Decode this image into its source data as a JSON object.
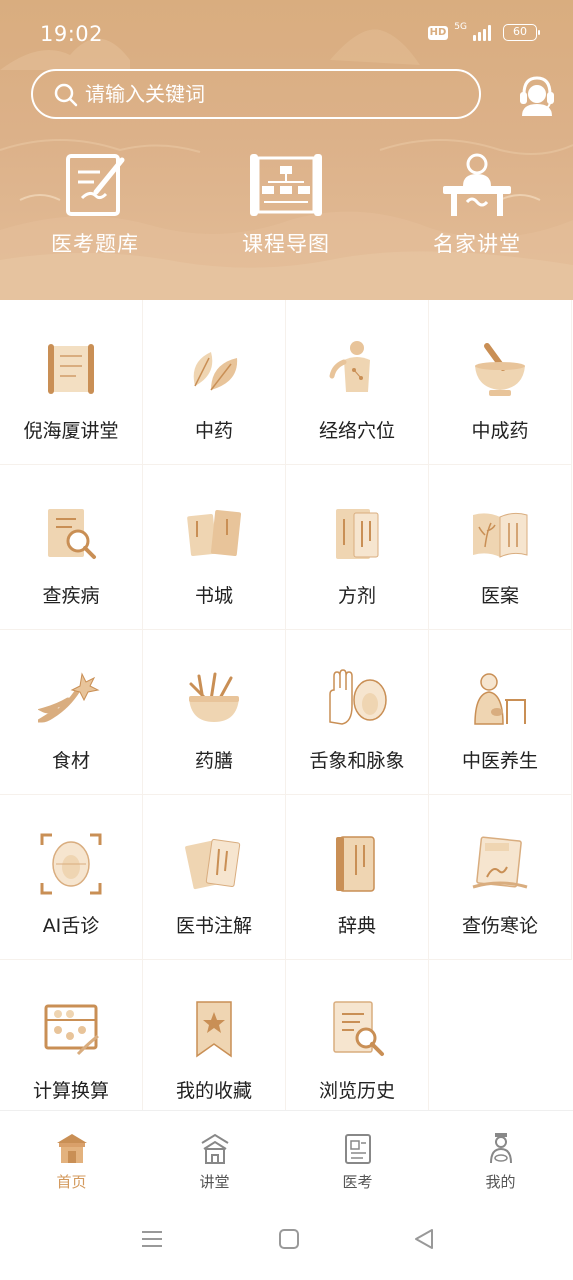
{
  "status_bar": {
    "time": "19:02",
    "hd": "HD",
    "network": "5G",
    "battery": "60"
  },
  "search": {
    "placeholder": "请输入关键词"
  },
  "quick_links": [
    {
      "label": "医考题库",
      "icon": "exam-question-bank-icon"
    },
    {
      "label": "课程导图",
      "icon": "course-map-icon"
    },
    {
      "label": "名家讲堂",
      "icon": "expert-lecture-icon"
    }
  ],
  "grid_items": [
    {
      "label": "倪海厦讲堂",
      "icon": "scroll-icon"
    },
    {
      "label": "中药",
      "icon": "herb-leaves-icon"
    },
    {
      "label": "经络穴位",
      "icon": "acupoint-body-icon"
    },
    {
      "label": "中成药",
      "icon": "mortar-pestle-icon"
    },
    {
      "label": "查疾病",
      "icon": "disease-search-icon"
    },
    {
      "label": "书城",
      "icon": "books-icon"
    },
    {
      "label": "方剂",
      "icon": "prescription-icon"
    },
    {
      "label": "医案",
      "icon": "medical-case-icon"
    },
    {
      "label": "食材",
      "icon": "ginseng-icon"
    },
    {
      "label": "药膳",
      "icon": "herbal-diet-icon"
    },
    {
      "label": "舌象和脉象",
      "icon": "tongue-pulse-icon"
    },
    {
      "label": "中医养生",
      "icon": "tcm-health-icon"
    },
    {
      "label": "AI舌诊",
      "icon": "ai-tongue-scan-icon"
    },
    {
      "label": "医书注解",
      "icon": "annotated-books-icon"
    },
    {
      "label": "辞典",
      "icon": "dictionary-icon"
    },
    {
      "label": "查伤寒论",
      "icon": "shanghan-book-icon"
    },
    {
      "label": "计算换算",
      "icon": "abacus-icon"
    },
    {
      "label": "我的收藏",
      "icon": "bookmark-star-icon"
    },
    {
      "label": "浏览历史",
      "icon": "history-doc-icon"
    }
  ],
  "bottom_nav": [
    {
      "label": "首页",
      "icon": "home-pavilion-icon",
      "active": true
    },
    {
      "label": "讲堂",
      "icon": "lecture-temple-icon",
      "active": false
    },
    {
      "label": "医考",
      "icon": "exam-card-icon",
      "active": false
    },
    {
      "label": "我的",
      "icon": "profile-figure-icon",
      "active": false
    }
  ],
  "colors": {
    "header_bg": "#d9ad7f",
    "icon_tan": "#e8c9a0",
    "icon_dark": "#c98f55",
    "active_tab": "#d39a5e",
    "text": "#222222"
  }
}
